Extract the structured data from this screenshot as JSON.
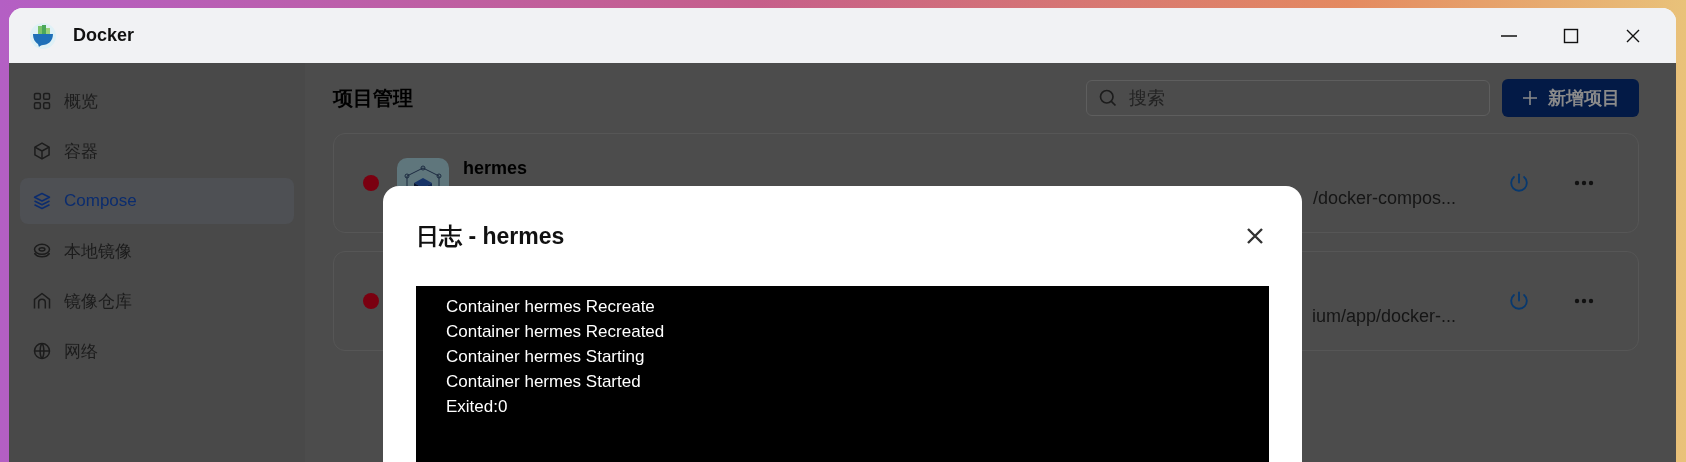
{
  "window": {
    "title": "Docker"
  },
  "sidebar": {
    "items": [
      {
        "label": "概览",
        "selected": false
      },
      {
        "label": "容器",
        "selected": false
      },
      {
        "label": "Compose",
        "selected": true
      },
      {
        "label": "本地镜像",
        "selected": false
      },
      {
        "label": "镜像仓库",
        "selected": false
      },
      {
        "label": "网络",
        "selected": false
      }
    ]
  },
  "page": {
    "title": "项目管理",
    "search": {
      "placeholder": "搜索"
    },
    "add_button": {
      "label": "新增项目"
    }
  },
  "projects": [
    {
      "name": "hermes",
      "path": "/docker-compos...",
      "color": "#7a0010"
    },
    {
      "path": "ium/app/docker-...",
      "color": "#7a0010"
    }
  ],
  "dialog": {
    "title": "日志 - hermes",
    "log_lines": [
      "Container hermes Recreate",
      "Container hermes Recreated",
      "Container hermes Starting",
      "Container hermes Started",
      "Exited:0"
    ]
  }
}
